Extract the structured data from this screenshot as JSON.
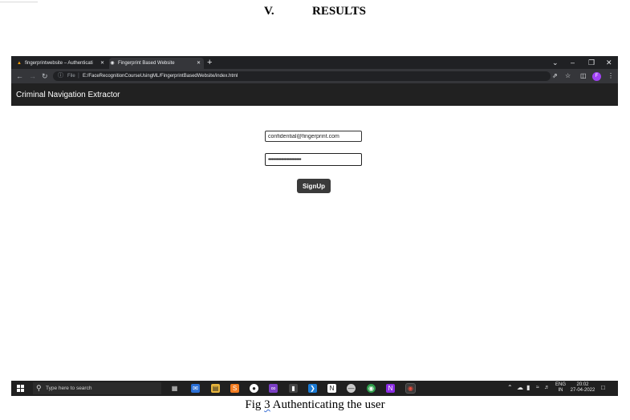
{
  "document": {
    "section_number": "V.",
    "section_title": "RESULTS",
    "caption_prefix": "Fig",
    "caption_number": "3",
    "caption_text": "Authenticating the user"
  },
  "browser": {
    "tabs": [
      {
        "label": "fingerprintwebsite – Authenticati",
        "icon": "firebase-icon",
        "active": false
      },
      {
        "label": "Fingerprint Based Website",
        "icon": "globe-icon",
        "active": true
      }
    ],
    "new_tab": "+",
    "file_label": "File",
    "url": "E:/FaceRecognitionCourseUsingML/FingerprintBasedWebsite/index.html",
    "profile_initial": "F"
  },
  "app": {
    "title": "Criminal Navigation Extractor",
    "email_value": "confidential@fingerprint.com",
    "password_mask": "••••••••••••••••••••••••••••",
    "signup_label": "SignUp"
  },
  "taskbar": {
    "search_placeholder": "Type here to search",
    "apps": [
      "task-view-icon",
      "mail-icon",
      "file-explorer-icon",
      "sublime-text-icon",
      "obs-icon",
      "visual-studio-icon",
      "terminal-icon",
      "vscode-icon",
      "notion-icon",
      "pill-app-icon",
      "chrome-icon",
      "onenote-icon",
      "chrome-profile-icon"
    ],
    "language_top": "ENG",
    "language_bottom": "IN",
    "time": "20:02",
    "date": "27-04-2022"
  },
  "colors": {
    "tab_bar": "#202124",
    "address_bar": "#35363a",
    "app_header": "#212121",
    "signup_button": "#3a3a3a",
    "taskbar": "#202020",
    "profile_avatar": "#a142f4"
  }
}
